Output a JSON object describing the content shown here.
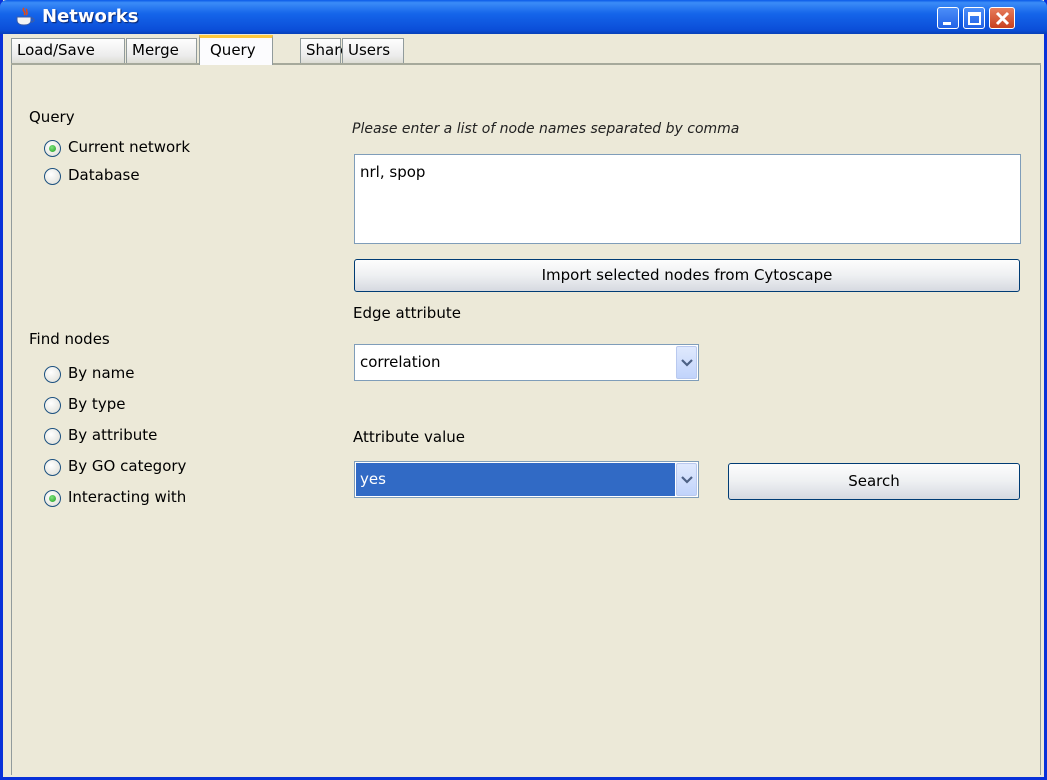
{
  "window": {
    "title": "Networks"
  },
  "tabs": [
    {
      "label": "Load/Save"
    },
    {
      "label": "Merge"
    },
    {
      "label": "Query"
    },
    {
      "label": "Share"
    },
    {
      "label": "Users"
    }
  ],
  "active_tab": "Query",
  "query": {
    "heading": "Query",
    "options": [
      {
        "label": "Current network",
        "selected": true
      },
      {
        "label": "Database",
        "selected": false
      }
    ]
  },
  "find_nodes": {
    "heading": "Find nodes",
    "options": [
      {
        "label": "By name",
        "selected": false
      },
      {
        "label": "By type",
        "selected": false
      },
      {
        "label": "By attribute",
        "selected": false
      },
      {
        "label": "By GO category",
        "selected": false
      },
      {
        "label": "Interacting with",
        "selected": true
      }
    ]
  },
  "node_list": {
    "hint": "Please enter a list of node names separated by comma",
    "value": "nrl, spop"
  },
  "import_button": {
    "label": "Import selected nodes from Cytoscape"
  },
  "edge_attribute": {
    "label": "Edge attribute",
    "value": "correlation"
  },
  "attribute_value": {
    "label": "Attribute value",
    "value": "yes"
  },
  "search_button": {
    "label": "Search"
  },
  "icons": {
    "app": "java-cup-icon",
    "minimize": "minimize-icon",
    "maximize": "maximize-icon",
    "close": "close-icon",
    "dropdown": "chevron-down-icon"
  },
  "colors": {
    "titlebar": "#0b4ed8",
    "active_tab_accent": "#ffc83c",
    "selection": "#316ac5",
    "panel_bg": "#ece9d8"
  }
}
